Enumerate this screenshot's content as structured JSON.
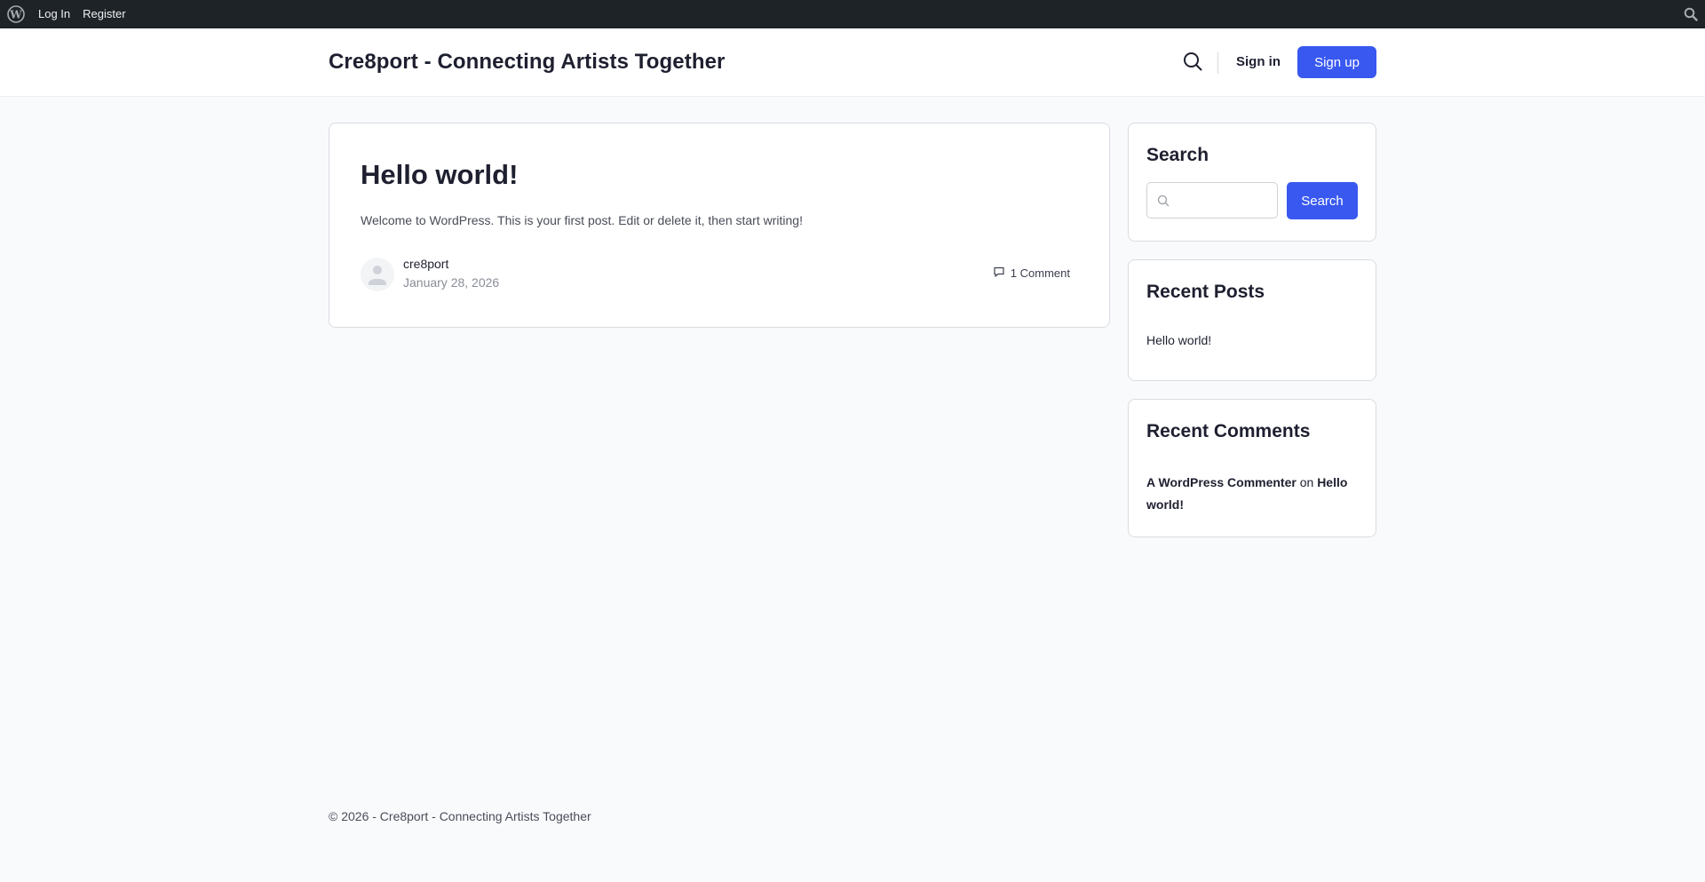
{
  "adminbar": {
    "login_label": "Log In",
    "register_label": "Register"
  },
  "header": {
    "site_title": "Cre8port - Connecting Artists Together",
    "signin_label": "Sign in",
    "signup_label": "Sign up",
    "accent_color": "#3858f0"
  },
  "post": {
    "title": "Hello world!",
    "excerpt": "Welcome to WordPress. This is your first post. Edit or delete it, then start writing!",
    "author": "cre8port",
    "date": "January 28, 2026",
    "comments": "1 Comment"
  },
  "sidebar": {
    "search": {
      "title": "Search",
      "button_label": "Search",
      "input_value": ""
    },
    "recent_posts": {
      "title": "Recent Posts",
      "items": [
        "Hello world!"
      ]
    },
    "recent_comments": {
      "title": "Recent Comments",
      "commenter": "A WordPress Commenter",
      "connector": "on",
      "post": "Hello world!"
    }
  },
  "footer": {
    "text": "© 2026 - Cre8port - Connecting Artists Together"
  }
}
